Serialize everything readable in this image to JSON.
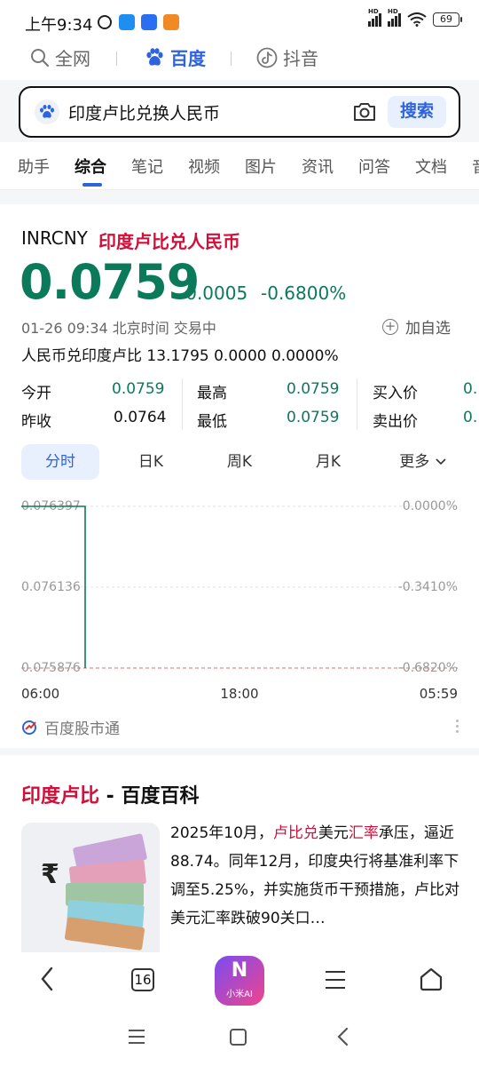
{
  "status_bar": {
    "time": "上午9:34",
    "battery": "69"
  },
  "channels": [
    {
      "label": "全网",
      "active": false
    },
    {
      "label": "百度",
      "active": true
    },
    {
      "label": "抖音",
      "active": false
    }
  ],
  "search": {
    "query": "印度卢比兑换人民币",
    "button": "搜索"
  },
  "tabs": [
    "助手",
    "综合",
    "笔记",
    "视频",
    "图片",
    "资讯",
    "问答",
    "文档",
    "音"
  ],
  "quote": {
    "code": "INRCNY",
    "name": "印度卢比兑人民币",
    "price": "0.0759",
    "change": "-0.0005",
    "change_pct": "-0.6800%",
    "meta": "01-26 09:34  北京时间  交易中",
    "add_watch": "加自选",
    "reverse": "人民币兑印度卢比  13.1795  0.0000  0.0000%",
    "stats": {
      "open_label": "今开",
      "open": "0.0759",
      "prev_label": "昨收",
      "prev": "0.0764",
      "high_label": "最高",
      "high": "0.0759",
      "low_label": "最低",
      "low": "0.0759",
      "buy_label": "买入价",
      "buy": "0.",
      "sell_label": "卖出价",
      "sell": "0."
    },
    "period_tabs": [
      "分时",
      "日K",
      "周K",
      "月K",
      "更多"
    ],
    "source": "百度股市通"
  },
  "chart_data": {
    "type": "line",
    "y_left_ticks": [
      "0.076397",
      "0.076136",
      "0.075876"
    ],
    "y_right_ticks": [
      "0.0000%",
      "-0.3410%",
      "-0.6820%"
    ],
    "x_ticks": [
      "06:00",
      "18:00",
      "05:59"
    ],
    "x": [
      "06:00",
      "06:00"
    ],
    "y": [
      0.076397,
      0.075876
    ],
    "ylim": [
      0.075876,
      0.076397
    ],
    "reference_line": 0.075876,
    "line_color": "#0b7a5a",
    "ref_color": "#e88a8a"
  },
  "baike": {
    "title_hl": "印度卢比",
    "title_rest": " - 百度百科",
    "text_1": "2025年10月，",
    "text_hl1": "卢比兑",
    "text_2": "美元",
    "text_hl2": "汇率",
    "text_3": "承压，逼近88.74。同年12月，印度央行将基准利率下调至5.25%，并实施货币干预措施，卢比对美元汇率跌破90关口…"
  },
  "bottom_nav": {
    "tab_count": "16",
    "ai_label": "小米AI"
  },
  "colors": {
    "accent": "#2d63e0",
    "down": "#0b7a5a",
    "highlight": "#d0103a"
  }
}
